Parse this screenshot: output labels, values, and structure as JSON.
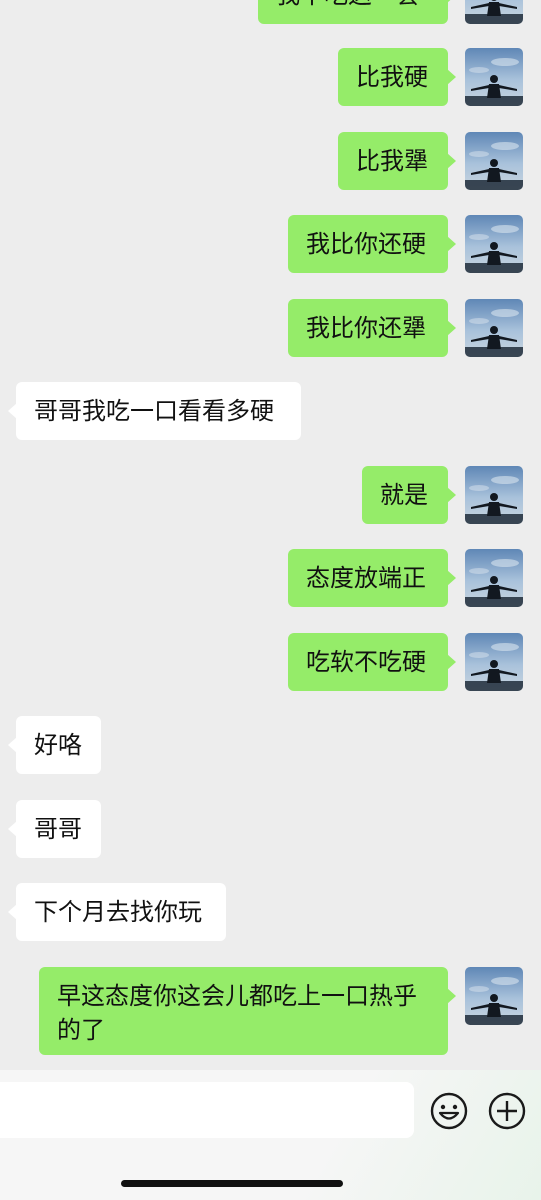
{
  "messages": [
    {
      "side": "out",
      "text": "我不吃这一套"
    },
    {
      "side": "out",
      "text": "比我硬"
    },
    {
      "side": "out",
      "text": "比我犟"
    },
    {
      "side": "out",
      "text": "我比你还硬"
    },
    {
      "side": "out",
      "text": "我比你还犟"
    },
    {
      "side": "in",
      "text": "哥哥我吃一口看看多硬"
    },
    {
      "side": "out",
      "text": "就是"
    },
    {
      "side": "out",
      "text": "态度放端正"
    },
    {
      "side": "out",
      "text": "吃软不吃硬"
    },
    {
      "side": "in",
      "text": "好咯"
    },
    {
      "side": "in",
      "text": "哥哥"
    },
    {
      "side": "in",
      "text": "下个月去找你玩"
    },
    {
      "side": "out",
      "text": "早这态度你这会儿都吃上一口热乎的了"
    }
  ],
  "input_bar": {
    "text_value": "",
    "emoji_icon": "emoji-icon",
    "plus_icon": "plus-icon"
  },
  "colors": {
    "background": "#ededed",
    "outgoing_bubble": "#95ec69",
    "incoming_bubble": "#ffffff"
  }
}
